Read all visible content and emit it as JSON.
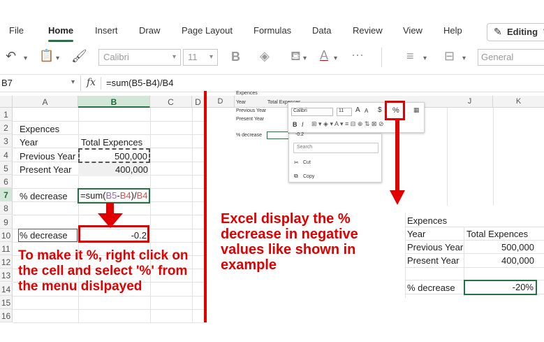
{
  "ribbon": {
    "tabs": [
      {
        "label": "File",
        "active": false
      },
      {
        "label": "Home",
        "active": true
      },
      {
        "label": "Insert",
        "active": false
      },
      {
        "label": "Draw",
        "active": false
      },
      {
        "label": "Page Layout",
        "active": false
      },
      {
        "label": "Formulas",
        "active": false
      },
      {
        "label": "Data",
        "active": false
      },
      {
        "label": "Review",
        "active": false
      },
      {
        "label": "View",
        "active": false
      },
      {
        "label": "Help",
        "active": false
      }
    ],
    "editing_label": "Editing",
    "font_name": "Calibri",
    "font_size": "11",
    "number_format": "General",
    "accent_color": "#217346",
    "icons": [
      "undo-icon",
      "paste-icon",
      "format-painter-icon",
      "bold-icon",
      "fill-color-icon",
      "font-color-icon",
      "more-icon",
      "align-icon",
      "merge-icon"
    ]
  },
  "formula_bar": {
    "name_box": "B7",
    "fx_label": "fx",
    "formula": "=sum(B5-B4)/B4"
  },
  "left_sheet": {
    "columns": [
      "A",
      "B",
      "C",
      "D"
    ],
    "rows": [
      "1",
      "2",
      "3",
      "4",
      "5",
      "6",
      "7",
      "8",
      "9",
      "10",
      "11",
      "12",
      "13",
      "14",
      "15",
      "16"
    ],
    "a2": "Expences",
    "a3": "Year",
    "b3": "Total Expences",
    "a4": "Previous Year",
    "b4": "500,000",
    "a5": "Present Year",
    "b5": "400,000",
    "a7": "% decrease",
    "b7_parts": {
      "p1": "=sum(",
      "p2": "B5",
      "p3": "-",
      "p4": "B4",
      "p5": ")/",
      "p6": "B4"
    },
    "a10": "% decrease",
    "b10": "-0.2"
  },
  "annotations": {
    "left_note": "To make it %, right click on the cell and select '%' from the menu dislpayed",
    "right_note": "Excel display the % decrease in negative values like shown in example",
    "color": "#e00000"
  },
  "mini_screenshot": {
    "cells": {
      "expences": "Expences",
      "year": "Year",
      "total": "Total Expences",
      "previous": "Previous Year",
      "present": "Present Year",
      "decrease": "% decrease",
      "b10": "-0.2"
    },
    "toolbar": {
      "font": "Calibri",
      "size": "11",
      "grow": "A",
      "shrink": "A",
      "currency": "$",
      "percent": "%",
      "bold": "B",
      "italic": "I"
    },
    "menu": {
      "search_placeholder": "Search",
      "cut": "Cut",
      "copy": "Copy"
    }
  },
  "right_sheet": {
    "columns": [
      "J",
      "K"
    ],
    "expences": "Expences",
    "year": "Year",
    "total": "Total Expences",
    "previous": "Previous Year",
    "prev_value": "500,000",
    "present": "Present Year",
    "present_value": "400,000",
    "decrease": "% decrease",
    "decrease_value": "-20%"
  }
}
